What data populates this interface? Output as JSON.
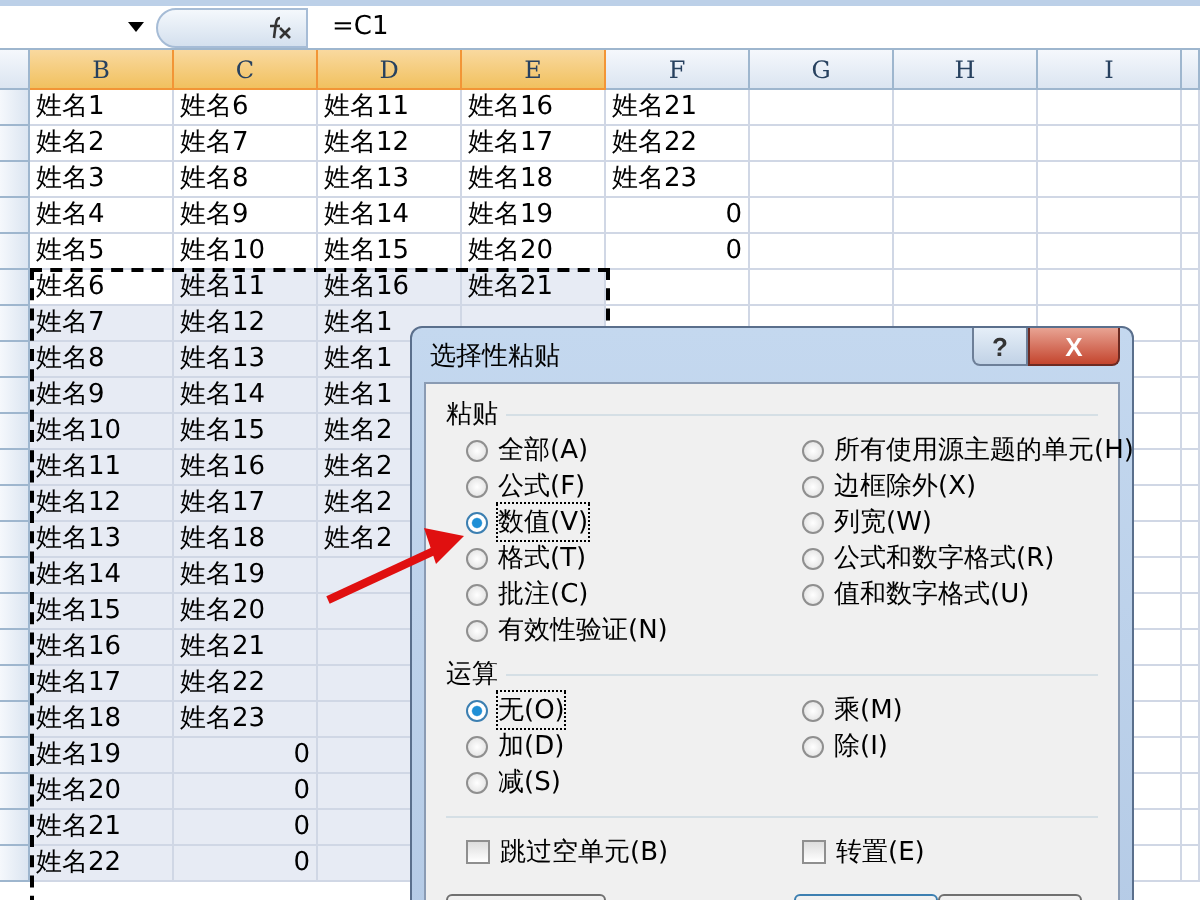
{
  "formula_bar": {
    "formula": "=C1"
  },
  "columns": [
    {
      "label": "B",
      "selected": true
    },
    {
      "label": "C",
      "selected": true
    },
    {
      "label": "D",
      "selected": true
    },
    {
      "label": "E",
      "selected": true
    },
    {
      "label": "F",
      "selected": false
    },
    {
      "label": "G",
      "selected": false
    },
    {
      "label": "H",
      "selected": false
    },
    {
      "label": "I",
      "selected": false
    }
  ],
  "rows": [
    {
      "selected": false,
      "cells": [
        {
          "text": "姓名1",
          "kind": "text"
        },
        {
          "text": "姓名6",
          "kind": "text"
        },
        {
          "text": "姓名11",
          "kind": "text"
        },
        {
          "text": "姓名16",
          "kind": "text"
        },
        {
          "text": "姓名21",
          "kind": "text"
        }
      ]
    },
    {
      "selected": false,
      "cells": [
        {
          "text": "姓名2",
          "kind": "text"
        },
        {
          "text": "姓名7",
          "kind": "text"
        },
        {
          "text": "姓名12",
          "kind": "text"
        },
        {
          "text": "姓名17",
          "kind": "text"
        },
        {
          "text": "姓名22",
          "kind": "text"
        }
      ]
    },
    {
      "selected": false,
      "cells": [
        {
          "text": "姓名3",
          "kind": "text"
        },
        {
          "text": "姓名8",
          "kind": "text"
        },
        {
          "text": "姓名13",
          "kind": "text"
        },
        {
          "text": "姓名18",
          "kind": "text"
        },
        {
          "text": "姓名23",
          "kind": "text"
        }
      ]
    },
    {
      "selected": false,
      "cells": [
        {
          "text": "姓名4",
          "kind": "text"
        },
        {
          "text": "姓名9",
          "kind": "text"
        },
        {
          "text": "姓名14",
          "kind": "text"
        },
        {
          "text": "姓名19",
          "kind": "text"
        },
        {
          "text": "0",
          "kind": "number"
        }
      ]
    },
    {
      "selected": false,
      "cells": [
        {
          "text": "姓名5",
          "kind": "text"
        },
        {
          "text": "姓名10",
          "kind": "text"
        },
        {
          "text": "姓名15",
          "kind": "text"
        },
        {
          "text": "姓名20",
          "kind": "text"
        },
        {
          "text": "0",
          "kind": "number"
        }
      ]
    },
    {
      "selected": true,
      "cells": [
        {
          "text": "姓名6",
          "kind": "text"
        },
        {
          "text": "姓名11",
          "kind": "text"
        },
        {
          "text": "姓名16",
          "kind": "text"
        },
        {
          "text": "姓名21",
          "kind": "text"
        }
      ]
    },
    {
      "selected": true,
      "cells": [
        {
          "text": "姓名7",
          "kind": "text"
        },
        {
          "text": "姓名12",
          "kind": "text"
        },
        {
          "text": "姓名1",
          "kind": "text"
        }
      ]
    },
    {
      "selected": true,
      "cells": [
        {
          "text": "姓名8",
          "kind": "text"
        },
        {
          "text": "姓名13",
          "kind": "text"
        },
        {
          "text": "姓名1",
          "kind": "text"
        }
      ]
    },
    {
      "selected": true,
      "cells": [
        {
          "text": "姓名9",
          "kind": "text"
        },
        {
          "text": "姓名14",
          "kind": "text"
        },
        {
          "text": "姓名1",
          "kind": "text"
        }
      ]
    },
    {
      "selected": true,
      "cells": [
        {
          "text": "姓名10",
          "kind": "text"
        },
        {
          "text": "姓名15",
          "kind": "text"
        },
        {
          "text": "姓名2",
          "kind": "text"
        }
      ]
    },
    {
      "selected": true,
      "cells": [
        {
          "text": "姓名11",
          "kind": "text"
        },
        {
          "text": "姓名16",
          "kind": "text"
        },
        {
          "text": "姓名2",
          "kind": "text"
        }
      ]
    },
    {
      "selected": true,
      "cells": [
        {
          "text": "姓名12",
          "kind": "text"
        },
        {
          "text": "姓名17",
          "kind": "text"
        },
        {
          "text": "姓名2",
          "kind": "text"
        }
      ]
    },
    {
      "selected": true,
      "cells": [
        {
          "text": "姓名13",
          "kind": "text"
        },
        {
          "text": "姓名18",
          "kind": "text"
        },
        {
          "text": "姓名2",
          "kind": "text"
        }
      ]
    },
    {
      "selected": true,
      "cells": [
        {
          "text": "姓名14",
          "kind": "text"
        },
        {
          "text": "姓名19",
          "kind": "text"
        }
      ]
    },
    {
      "selected": true,
      "cells": [
        {
          "text": "姓名15",
          "kind": "text"
        },
        {
          "text": "姓名20",
          "kind": "text"
        }
      ]
    },
    {
      "selected": true,
      "cells": [
        {
          "text": "姓名16",
          "kind": "text"
        },
        {
          "text": "姓名21",
          "kind": "text"
        }
      ]
    },
    {
      "selected": true,
      "cells": [
        {
          "text": "姓名17",
          "kind": "text"
        },
        {
          "text": "姓名22",
          "kind": "text"
        }
      ]
    },
    {
      "selected": true,
      "cells": [
        {
          "text": "姓名18",
          "kind": "text"
        },
        {
          "text": "姓名23",
          "kind": "text"
        }
      ]
    },
    {
      "selected": true,
      "cells": [
        {
          "text": "姓名19",
          "kind": "text"
        },
        {
          "text": "0",
          "kind": "number"
        }
      ]
    },
    {
      "selected": true,
      "cells": [
        {
          "text": "姓名20",
          "kind": "text"
        },
        {
          "text": "0",
          "kind": "number"
        }
      ]
    },
    {
      "selected": true,
      "cells": [
        {
          "text": "姓名21",
          "kind": "text"
        },
        {
          "text": "0",
          "kind": "number"
        }
      ]
    },
    {
      "selected": true,
      "cells": [
        {
          "text": "姓名22",
          "kind": "text"
        },
        {
          "text": "0",
          "kind": "number"
        }
      ]
    }
  ],
  "dialog": {
    "title": "选择性粘贴",
    "help": "?",
    "close": "X",
    "paste": {
      "label": "粘贴",
      "options": [
        {
          "label": "全部(A)",
          "selected": false
        },
        {
          "label": "所有使用源主题的单元(H)",
          "selected": false
        },
        {
          "label": "公式(F)",
          "selected": false
        },
        {
          "label": "边框除外(X)",
          "selected": false
        },
        {
          "label": "数值(V)",
          "selected": true
        },
        {
          "label": "列宽(W)",
          "selected": false
        },
        {
          "label": "格式(T)",
          "selected": false
        },
        {
          "label": "公式和数字格式(R)",
          "selected": false
        },
        {
          "label": "批注(C)",
          "selected": false
        },
        {
          "label": "值和数字格式(U)",
          "selected": false
        },
        {
          "label": "有效性验证(N)",
          "selected": false
        }
      ]
    },
    "operation": {
      "label": "运算",
      "options": [
        {
          "label": "无(O)",
          "selected": true
        },
        {
          "label": "乘(M)",
          "selected": false
        },
        {
          "label": "加(D)",
          "selected": false
        },
        {
          "label": "除(I)",
          "selected": false
        },
        {
          "label": "减(S)",
          "selected": false
        }
      ]
    },
    "checkboxes": [
      {
        "label": "跳过空单元(B)",
        "checked": false
      },
      {
        "label": "转置(E)",
        "checked": false
      }
    ],
    "buttons": [
      {
        "default": false
      },
      {
        "default": true
      },
      {
        "default": false
      }
    ]
  }
}
